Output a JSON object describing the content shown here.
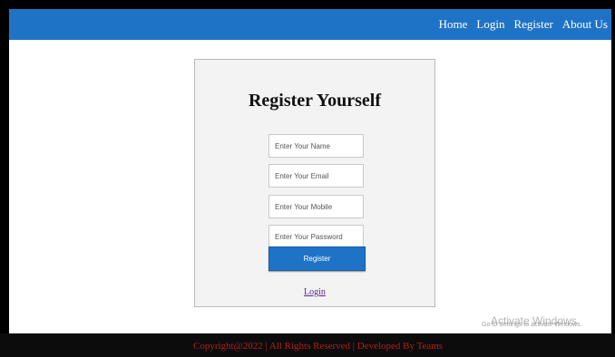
{
  "nav": {
    "items": [
      {
        "label": "Home"
      },
      {
        "label": "Login"
      },
      {
        "label": "Register"
      },
      {
        "label": "About Us"
      }
    ]
  },
  "form": {
    "title": "Register Yourself",
    "name_placeholder": "Enter Your Name",
    "email_placeholder": "Enter Your Email",
    "mobile_placeholder": "Enter Your Mobile",
    "password_placeholder": "Enter Your Password",
    "submit_label": "Register",
    "login_link": "Login"
  },
  "footer": {
    "text": "Copyright@2022 | All Rights Reserved | Developed By Teams"
  },
  "watermark": {
    "line1": "Activate Windows",
    "line2": "Go to Settings to activate Windows."
  },
  "colors": {
    "topbar": "#1f73c7",
    "button": "#1f73c7",
    "footer_bg": "#0c0c0c",
    "footer_text": "#b21f1f",
    "link": "#5b2a86"
  }
}
